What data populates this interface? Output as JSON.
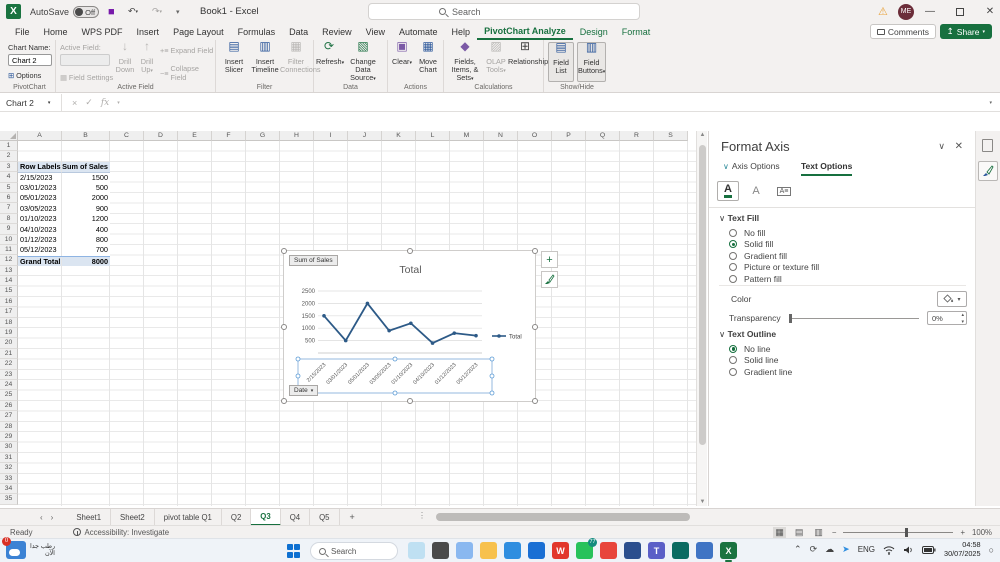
{
  "titlebar": {
    "autosave_label": "AutoSave",
    "autosave_state": "Off",
    "doc_title": "Book1 - Excel",
    "search_placeholder": "Search",
    "avatar_initials": "ME"
  },
  "ribbon_tabs": [
    {
      "label": "File"
    },
    {
      "label": "Home"
    },
    {
      "label": "WPS PDF"
    },
    {
      "label": "Insert"
    },
    {
      "label": "Page Layout"
    },
    {
      "label": "Formulas"
    },
    {
      "label": "Data"
    },
    {
      "label": "Review"
    },
    {
      "label": "View"
    },
    {
      "label": "Automate"
    },
    {
      "label": "Help"
    },
    {
      "label": "PivotChart Analyze",
      "active": true
    },
    {
      "label": "Design",
      "contextual": true
    },
    {
      "label": "Format",
      "contextual": true
    }
  ],
  "tabrow": {
    "comments": "Comments",
    "share": "Share"
  },
  "ribbon": {
    "groups": [
      "PivotChart",
      "Active Field",
      "Filter",
      "Data",
      "Actions",
      "Calculations",
      "Show/Hide"
    ],
    "chart_name_label": "Chart Name:",
    "chart_name_value": "Chart 2",
    "options": "Options",
    "active_field_label": "Active Field:",
    "field_settings": "Field Settings",
    "drill_down": "Drill Down",
    "drill_up": "Drill Up",
    "expand_field": "Expand Field",
    "collapse_field": "Collapse Field",
    "insert_slicer": "Insert Slicer",
    "insert_timeline": "Insert Timeline",
    "filter_connections": "Filter Connections",
    "refresh": "Refresh",
    "change_data_source": "Change Data Source",
    "clear": "Clear",
    "move_chart": "Move Chart",
    "fields_items_sets": "Fields, Items, & Sets",
    "olap_tools": "OLAP Tools",
    "relationships": "Relationships",
    "field_list": "Field List",
    "field_buttons": "Field Buttons"
  },
  "formula_bar": {
    "name_box": "Chart 2"
  },
  "grid": {
    "columns": [
      "A",
      "B",
      "C",
      "D",
      "E",
      "F",
      "G",
      "H",
      "I",
      "J",
      "K",
      "L",
      "M",
      "N",
      "O",
      "P",
      "Q",
      "R",
      "S"
    ],
    "row_count": 35
  },
  "pivot": {
    "header": [
      "Row Labels",
      "Sum of Sales"
    ],
    "rows": [
      [
        "2/15/2023",
        "1500"
      ],
      [
        "03/01/2023",
        "500"
      ],
      [
        "05/01/2023",
        "2000"
      ],
      [
        "03/05/2023",
        "900"
      ],
      [
        "01/10/2023",
        "1200"
      ],
      [
        "04/10/2023",
        "400"
      ],
      [
        "01/12/2023",
        "800"
      ],
      [
        "05/12/2023",
        "700"
      ]
    ],
    "total": [
      "Grand Total",
      "8000"
    ]
  },
  "chart_data": {
    "type": "line",
    "title": "Total",
    "categories": [
      "2/15/2023",
      "03/01/2023",
      "05/01/2023",
      "03/05/2023",
      "01/10/2023",
      "04/10/2023",
      "01/12/2023",
      "05/12/2023"
    ],
    "values": [
      1500,
      500,
      2000,
      900,
      1200,
      400,
      800,
      700
    ],
    "ylim": [
      0,
      2500
    ],
    "yticks": [
      500,
      1000,
      1500,
      2000,
      2500
    ],
    "legend": "Total",
    "legend_position": "right",
    "grid": true,
    "series_color": "#2d5a87",
    "value_field_button": "Sum of Sales",
    "axis_field_button": "Date"
  },
  "format_pane": {
    "title": "Format Axis",
    "tab_axis": "Axis Options",
    "tab_text": "Text Options",
    "sections": [
      {
        "title": "Text Fill",
        "options": [
          {
            "label": "No fill",
            "selected": false
          },
          {
            "label": "Solid fill",
            "selected": true
          },
          {
            "label": "Gradient fill",
            "selected": false
          },
          {
            "label": "Picture or texture fill",
            "selected": false
          },
          {
            "label": "Pattern fill",
            "selected": false
          }
        ]
      },
      {
        "title": "Text Outline",
        "options": [
          {
            "label": "No line",
            "selected": true
          },
          {
            "label": "Solid line",
            "selected": false
          },
          {
            "label": "Gradient line",
            "selected": false
          }
        ]
      }
    ],
    "color_label": "Color",
    "transparency_label": "Transparency",
    "transparency_value": "0%"
  },
  "sheetbar": {
    "tabs": [
      "Sheet1",
      "Sheet2",
      "pivot table Q1",
      "Q2",
      "Q3",
      "Q4",
      "Q5"
    ],
    "active": "Q3"
  },
  "statusbar": {
    "ready": "Ready",
    "accessibility": "Accessibility: Investigate",
    "zoom": "100%"
  },
  "taskbar": {
    "weather": [
      "رطب جدا",
      "الآن"
    ],
    "weather_badge": "0",
    "search_placeholder": "Search",
    "icons": [
      {
        "name": "widgets-icon",
        "color": "#bfe0f2"
      },
      {
        "name": "taskview-icon",
        "color": "#4a4a4a"
      },
      {
        "name": "copilot-icon",
        "color": "#8ab8f0"
      },
      {
        "name": "file-explorer-icon",
        "color": "#f7c14d"
      },
      {
        "name": "edge-icon",
        "color": "#2f8ee0"
      },
      {
        "name": "store-icon",
        "color": "#1a6fd4"
      },
      {
        "name": "wps-icon",
        "color": "#e2372c",
        "glyph": "W"
      },
      {
        "name": "whatsapp-icon",
        "color": "#27c25b",
        "badge": "77"
      },
      {
        "name": "chrome-icon",
        "color": "#e8453c"
      },
      {
        "name": "app-blue-icon",
        "color": "#2b4f8e"
      },
      {
        "name": "teams-icon",
        "color": "#5b5fc7",
        "glyph": "T"
      },
      {
        "name": "app-teal-icon",
        "color": "#0b6b62"
      },
      {
        "name": "database-icon",
        "color": "#3f74c4"
      },
      {
        "name": "excel-icon",
        "color": "#1a7340",
        "glyph": "X",
        "running": true
      }
    ],
    "lang": "ENG",
    "time": "04:58",
    "date": "30/07/2025"
  }
}
